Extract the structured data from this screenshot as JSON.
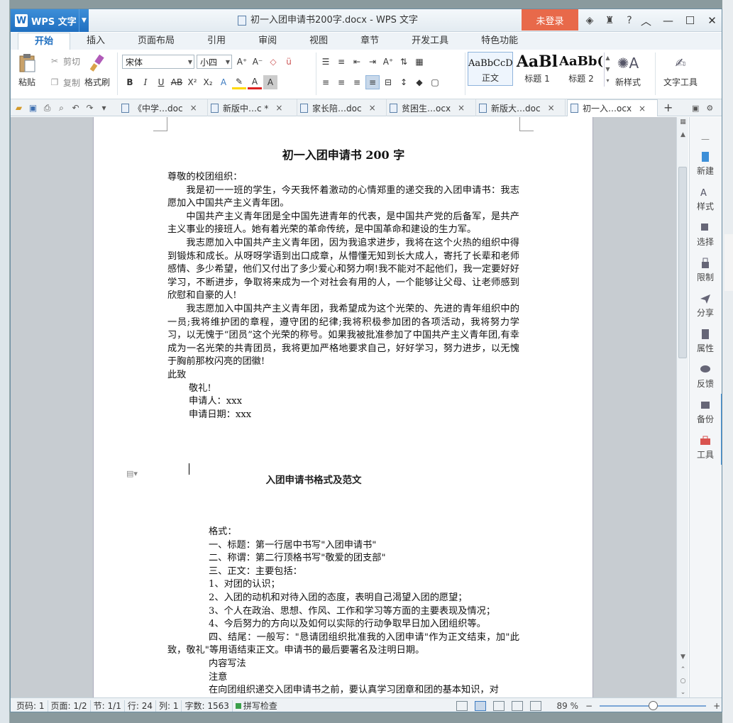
{
  "window": {
    "app_name": "WPS 文字",
    "app_logo": "W",
    "title": "初一入团申请书200字.docx - WPS 文字",
    "login": "未登录",
    "help": "?"
  },
  "ribbon_tabs": [
    "开始",
    "插入",
    "页面布局",
    "引用",
    "审阅",
    "视图",
    "章节",
    "开发工具",
    "特色功能"
  ],
  "ribbon": {
    "paste": "粘贴",
    "cut": "剪切",
    "copy": "复制",
    "format_painter": "格式刷",
    "font_name": "宋体",
    "font_size": "小四",
    "styles": [
      {
        "sample": "AaBbCcD",
        "label": "正文"
      },
      {
        "sample": "AaBl",
        "label": "标题 1"
      },
      {
        "sample": "AaBb(",
        "label": "标题 2"
      }
    ],
    "new_style": "新样式",
    "text_tools": "文字工具"
  },
  "doc_tabs": [
    {
      "label": "《中学…doc",
      "close": "×"
    },
    {
      "label": "新版中…c *",
      "close": "×"
    },
    {
      "label": "家长陪…doc",
      "close": "×"
    },
    {
      "label": "贫困生…ocx",
      "close": "×"
    },
    {
      "label": "新版大…doc",
      "close": "×"
    },
    {
      "label": "初一入…ocx",
      "close": "×"
    }
  ],
  "document": {
    "title": "初一入团申请书 200 字",
    "salutation": "尊敬的校团组织：",
    "paragraphs": [
      "我是初一一班的学生，今天我怀着激动的心情郑重的递交我的入团申请书：我志愿加入中国共产主义青年团。",
      "中国共产主义青年团是全中国先进青年的代表，是中国共产党的后备军，是共产主义事业的接班人。她有着光荣的革命传统，是中国革命和建设的生力军。",
      "我志愿加入中国共产主义青年团，因为我追求进步，我将在这个火热的组织中得到锻炼和成长。从呀呀学语到出口成章，从懵懂无知到长大成人，寄托了长辈和老师感情、多少希望，他们又付出了多少爱心和努力啊!我不能对不起他们，我一定要好好学习，不断进步，争取将来成为一个对社会有用的人，一个能够让父母、让老师感到欣慰和自豪的人!",
      "我志愿加入中国共产主义青年团，我希望成为这个光荣的、先进的青年组织中的一员;我将维护团的章程，遵守团的纪律;我将积极参加团的各项活动，我将努力学习，以无愧于“团员”这个光荣的称号。如果我被批准参加了中国共产主义青年团,有幸成为一名光荣的共青团员，我将更加严格地要求自己，好好学习，努力进步，以无愧于胸前那枚闪亮的团徽!"
    ],
    "closing": "此致",
    "respect": "敬礼!",
    "applicant": "申请人：xxx",
    "date": "申请日期：xxx",
    "section_title": "入团申请书格式及范文",
    "format_lines": [
      "格式：",
      "一、标题：第一行居中书写\"入团申请书\"",
      "二、称谓：第二行顶格书写\"敬爱的团支部\"",
      "三、正文：主要包括：",
      "1、对团的认识；",
      "2、入团的动机和对待入团的态度，表明自己渴望入团的愿望；",
      "3、个人在政治、思想、作风、工作和学习等方面的主要表现及情况；",
      "4、今后努力的方向以及如何以实际的行动争取早日加入团组织等。"
    ],
    "ending_para": "四、结尾：一般写：\"恳请团组织批准我的入团申请\"作为正文结束，加\"此致，敬礼\"等用语结束正文。申请书的最后要署名及注明日期。",
    "tail_lines": [
      "内容写法",
      "注意"
    ],
    "last_line": "在向团组织递交入团申请书之前，要认真学习团章和团的基本知识，对"
  },
  "side_panel": [
    "新建",
    "样式",
    "选择",
    "限制",
    "分享",
    "属性",
    "反馈",
    "备份",
    "工具"
  ],
  "status": {
    "page_code": "页码: 1",
    "page": "页面: 1/2",
    "section": "节: 1/1",
    "row": "行: 24",
    "col": "列: 1",
    "words": "字数: 1563",
    "spell": "拼写检查",
    "zoom": "89 %",
    "zoom_minus": "−",
    "zoom_plus": "+",
    "zoom_fraction": 0.5
  },
  "colors": {
    "accent": "#1f6fc0",
    "login": "#e8694a",
    "spell_ok": "#3aa04a"
  }
}
